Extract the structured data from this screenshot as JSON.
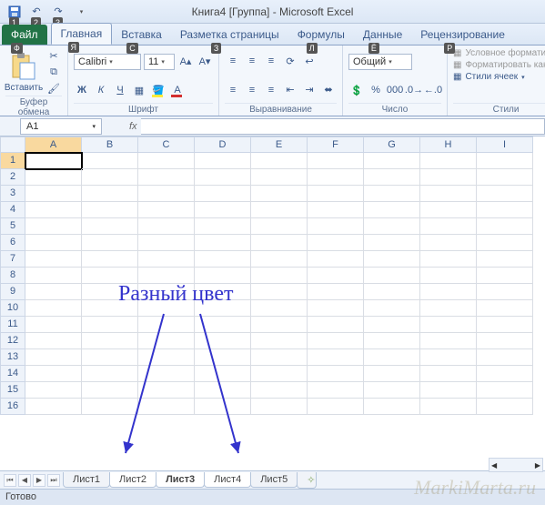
{
  "title": "Книга4  [Группа]  -  Microsoft Excel",
  "tabs": {
    "file": "Файл",
    "home": "Главная",
    "insert": "Вставка",
    "layout": "Разметка страницы",
    "formulas": "Формулы",
    "data": "Данные",
    "review": "Рецензирование"
  },
  "keytips": {
    "file": "Ф",
    "qat1": "1",
    "qat2": "2",
    "qat3": "3",
    "home": "Я",
    "insert": "С",
    "layout": "З",
    "formulas": "Л",
    "data": "Ё",
    "review": "Р"
  },
  "ribbon": {
    "clipboard": {
      "paste": "Вставить",
      "label": "Буфер обмена"
    },
    "font": {
      "name": "Calibri",
      "size": "11",
      "label": "Шрифт",
      "bold": "Ж",
      "italic": "К",
      "underline": "Ч"
    },
    "align": {
      "label": "Выравнивание"
    },
    "number": {
      "format": "Общий",
      "label": "Число"
    },
    "styles": {
      "cond": "Условное форматиро",
      "table": "Форматировать как та",
      "cell": "Стили ячеек",
      "label": "Стили"
    }
  },
  "namebox": "A1",
  "fx_label": "fx",
  "columns": [
    "A",
    "B",
    "C",
    "D",
    "E",
    "F",
    "G",
    "H",
    "I"
  ],
  "rows": [
    "1",
    "2",
    "3",
    "4",
    "5",
    "6",
    "7",
    "8",
    "9",
    "10",
    "11",
    "12",
    "13",
    "14",
    "15",
    "16"
  ],
  "sheets": [
    "Лист1",
    "Лист2",
    "Лист3",
    "Лист4",
    "Лист5"
  ],
  "status": "Готово",
  "annotation": "Разный цвет",
  "watermark": "MarkiMarta.ru"
}
